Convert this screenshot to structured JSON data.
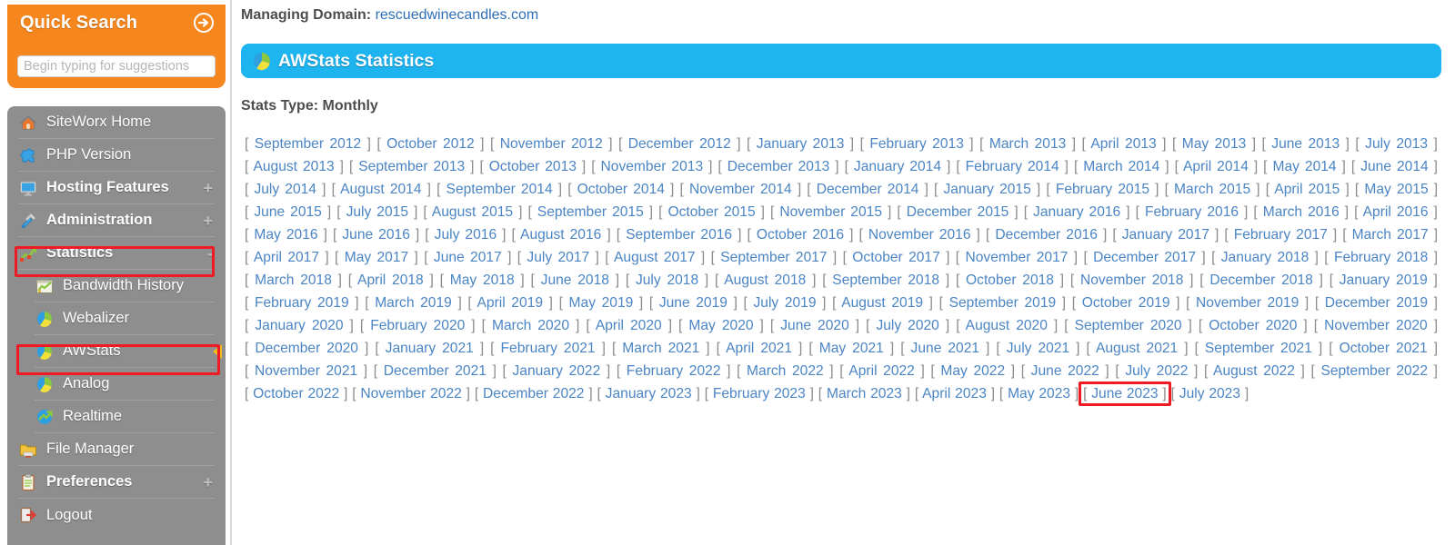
{
  "colors": {
    "sidebar_orange": "#f6871f",
    "sidebar_gray": "#8e8e8e",
    "banner_blue": "#1eb4ef",
    "link_blue": "#4b85c4",
    "highlight_red": "#ee1b24",
    "flag_yellow": "#f6b91d"
  },
  "sidebar": {
    "quick_search": {
      "title": "Quick Search",
      "arrow_icon": "arrow-circle-right-icon",
      "input_placeholder": "Begin typing for suggestions",
      "input_value": ""
    },
    "items": [
      {
        "label": "SiteWorx Home",
        "icon": "home-icon",
        "level": 0,
        "bold": false,
        "expander": ""
      },
      {
        "label": "PHP Version",
        "icon": "puzzle-piece-icon",
        "level": 0,
        "bold": false,
        "expander": ""
      },
      {
        "label": "Hosting Features",
        "icon": "monitor-icon",
        "level": 0,
        "bold": true,
        "expander": "+"
      },
      {
        "label": "Administration",
        "icon": "tools-icon",
        "level": 0,
        "bold": true,
        "expander": "+"
      },
      {
        "label": "Statistics",
        "icon": "statistics-chart-icon",
        "level": 0,
        "bold": true,
        "expander": "-"
      },
      {
        "label": "Bandwidth History",
        "icon": "bandwidth-chart-icon",
        "level": 1,
        "bold": false,
        "expander": ""
      },
      {
        "label": "Webalizer",
        "icon": "pie-chart-icon",
        "level": 1,
        "bold": false,
        "expander": ""
      },
      {
        "label": "AWStats",
        "icon": "pie-chart-icon",
        "level": 1,
        "bold": false,
        "expander": "",
        "selected": true
      },
      {
        "label": "Analog",
        "icon": "pie-chart-icon",
        "level": 1,
        "bold": false,
        "expander": ""
      },
      {
        "label": "Realtime",
        "icon": "realtime-globe-icon",
        "level": 1,
        "bold": false,
        "expander": ""
      },
      {
        "label": "File Manager",
        "icon": "folder-icon",
        "level": 0,
        "bold": false,
        "expander": ""
      },
      {
        "label": "Preferences",
        "icon": "clipboard-icon",
        "level": 0,
        "bold": true,
        "expander": "+"
      },
      {
        "label": "Logout",
        "icon": "logout-icon",
        "level": 0,
        "bold": false,
        "expander": ""
      }
    ]
  },
  "main": {
    "managing_domain_label": "Managing Domain:",
    "managing_domain_value": "rescuedwinecandles.com",
    "banner_title": "AWStats Statistics",
    "banner_icon": "pie-chart-icon",
    "stats_type_line": "Stats Type: Monthly",
    "month_links": [
      "September 2012",
      "October 2012",
      "November 2012",
      "December 2012",
      "January 2013",
      "February 2013",
      "March 2013",
      "April 2013",
      "May 2013",
      "June 2013",
      "July 2013",
      "August 2013",
      "September 2013",
      "October 2013",
      "November 2013",
      "December 2013",
      "January 2014",
      "February 2014",
      "March 2014",
      "April 2014",
      "May 2014",
      "June 2014",
      "July 2014",
      "August 2014",
      "September 2014",
      "October 2014",
      "November 2014",
      "December 2014",
      "January 2015",
      "February 2015",
      "March 2015",
      "April 2015",
      "May 2015",
      "June 2015",
      "July 2015",
      "August 2015",
      "September 2015",
      "October 2015",
      "November 2015",
      "December 2015",
      "January 2016",
      "February 2016",
      "March 2016",
      "April 2016",
      "May 2016",
      "June 2016",
      "July 2016",
      "August 2016",
      "September 2016",
      "October 2016",
      "November 2016",
      "December 2016",
      "January 2017",
      "February 2017",
      "March 2017",
      "April 2017",
      "May 2017",
      "June 2017",
      "July 2017",
      "August 2017",
      "September 2017",
      "October 2017",
      "November 2017",
      "December 2017",
      "January 2018",
      "February 2018",
      "March 2018",
      "April 2018",
      "May 2018",
      "June 2018",
      "July 2018",
      "August 2018",
      "September 2018",
      "October 2018",
      "November 2018",
      "December 2018",
      "January 2019",
      "February 2019",
      "March 2019",
      "April 2019",
      "May 2019",
      "June 2019",
      "July 2019",
      "August 2019",
      "September 2019",
      "October 2019",
      "November 2019",
      "December 2019",
      "January 2020",
      "February 2020",
      "March 2020",
      "April 2020",
      "May 2020",
      "June 2020",
      "July 2020",
      "August 2020",
      "September 2020",
      "October 2020",
      "November 2020",
      "December 2020",
      "January 2021",
      "February 2021",
      "March 2021",
      "April 2021",
      "May 2021",
      "June 2021",
      "July 2021",
      "August 2021",
      "September 2021",
      "October 2021",
      "November 2021",
      "December 2021",
      "January 2022",
      "February 2022",
      "March 2022",
      "April 2022",
      "May 2022",
      "June 2022",
      "July 2022",
      "August 2022",
      "September 2022",
      "October 2022",
      "November 2022",
      "December 2022",
      "January 2023",
      "February 2023",
      "March 2023",
      "April 2023",
      "May 2023",
      "June 2023",
      "July 2023"
    ],
    "highlighted_month": "June 2023",
    "bracket_open": "[",
    "bracket_close": "]"
  },
  "annotations": [
    {
      "name": "statistics-menu-highlight",
      "target": "Statistics"
    },
    {
      "name": "awstats-menu-highlight",
      "target": "AWStats"
    },
    {
      "name": "june-2023-link-highlight",
      "target": "June 2023"
    }
  ]
}
